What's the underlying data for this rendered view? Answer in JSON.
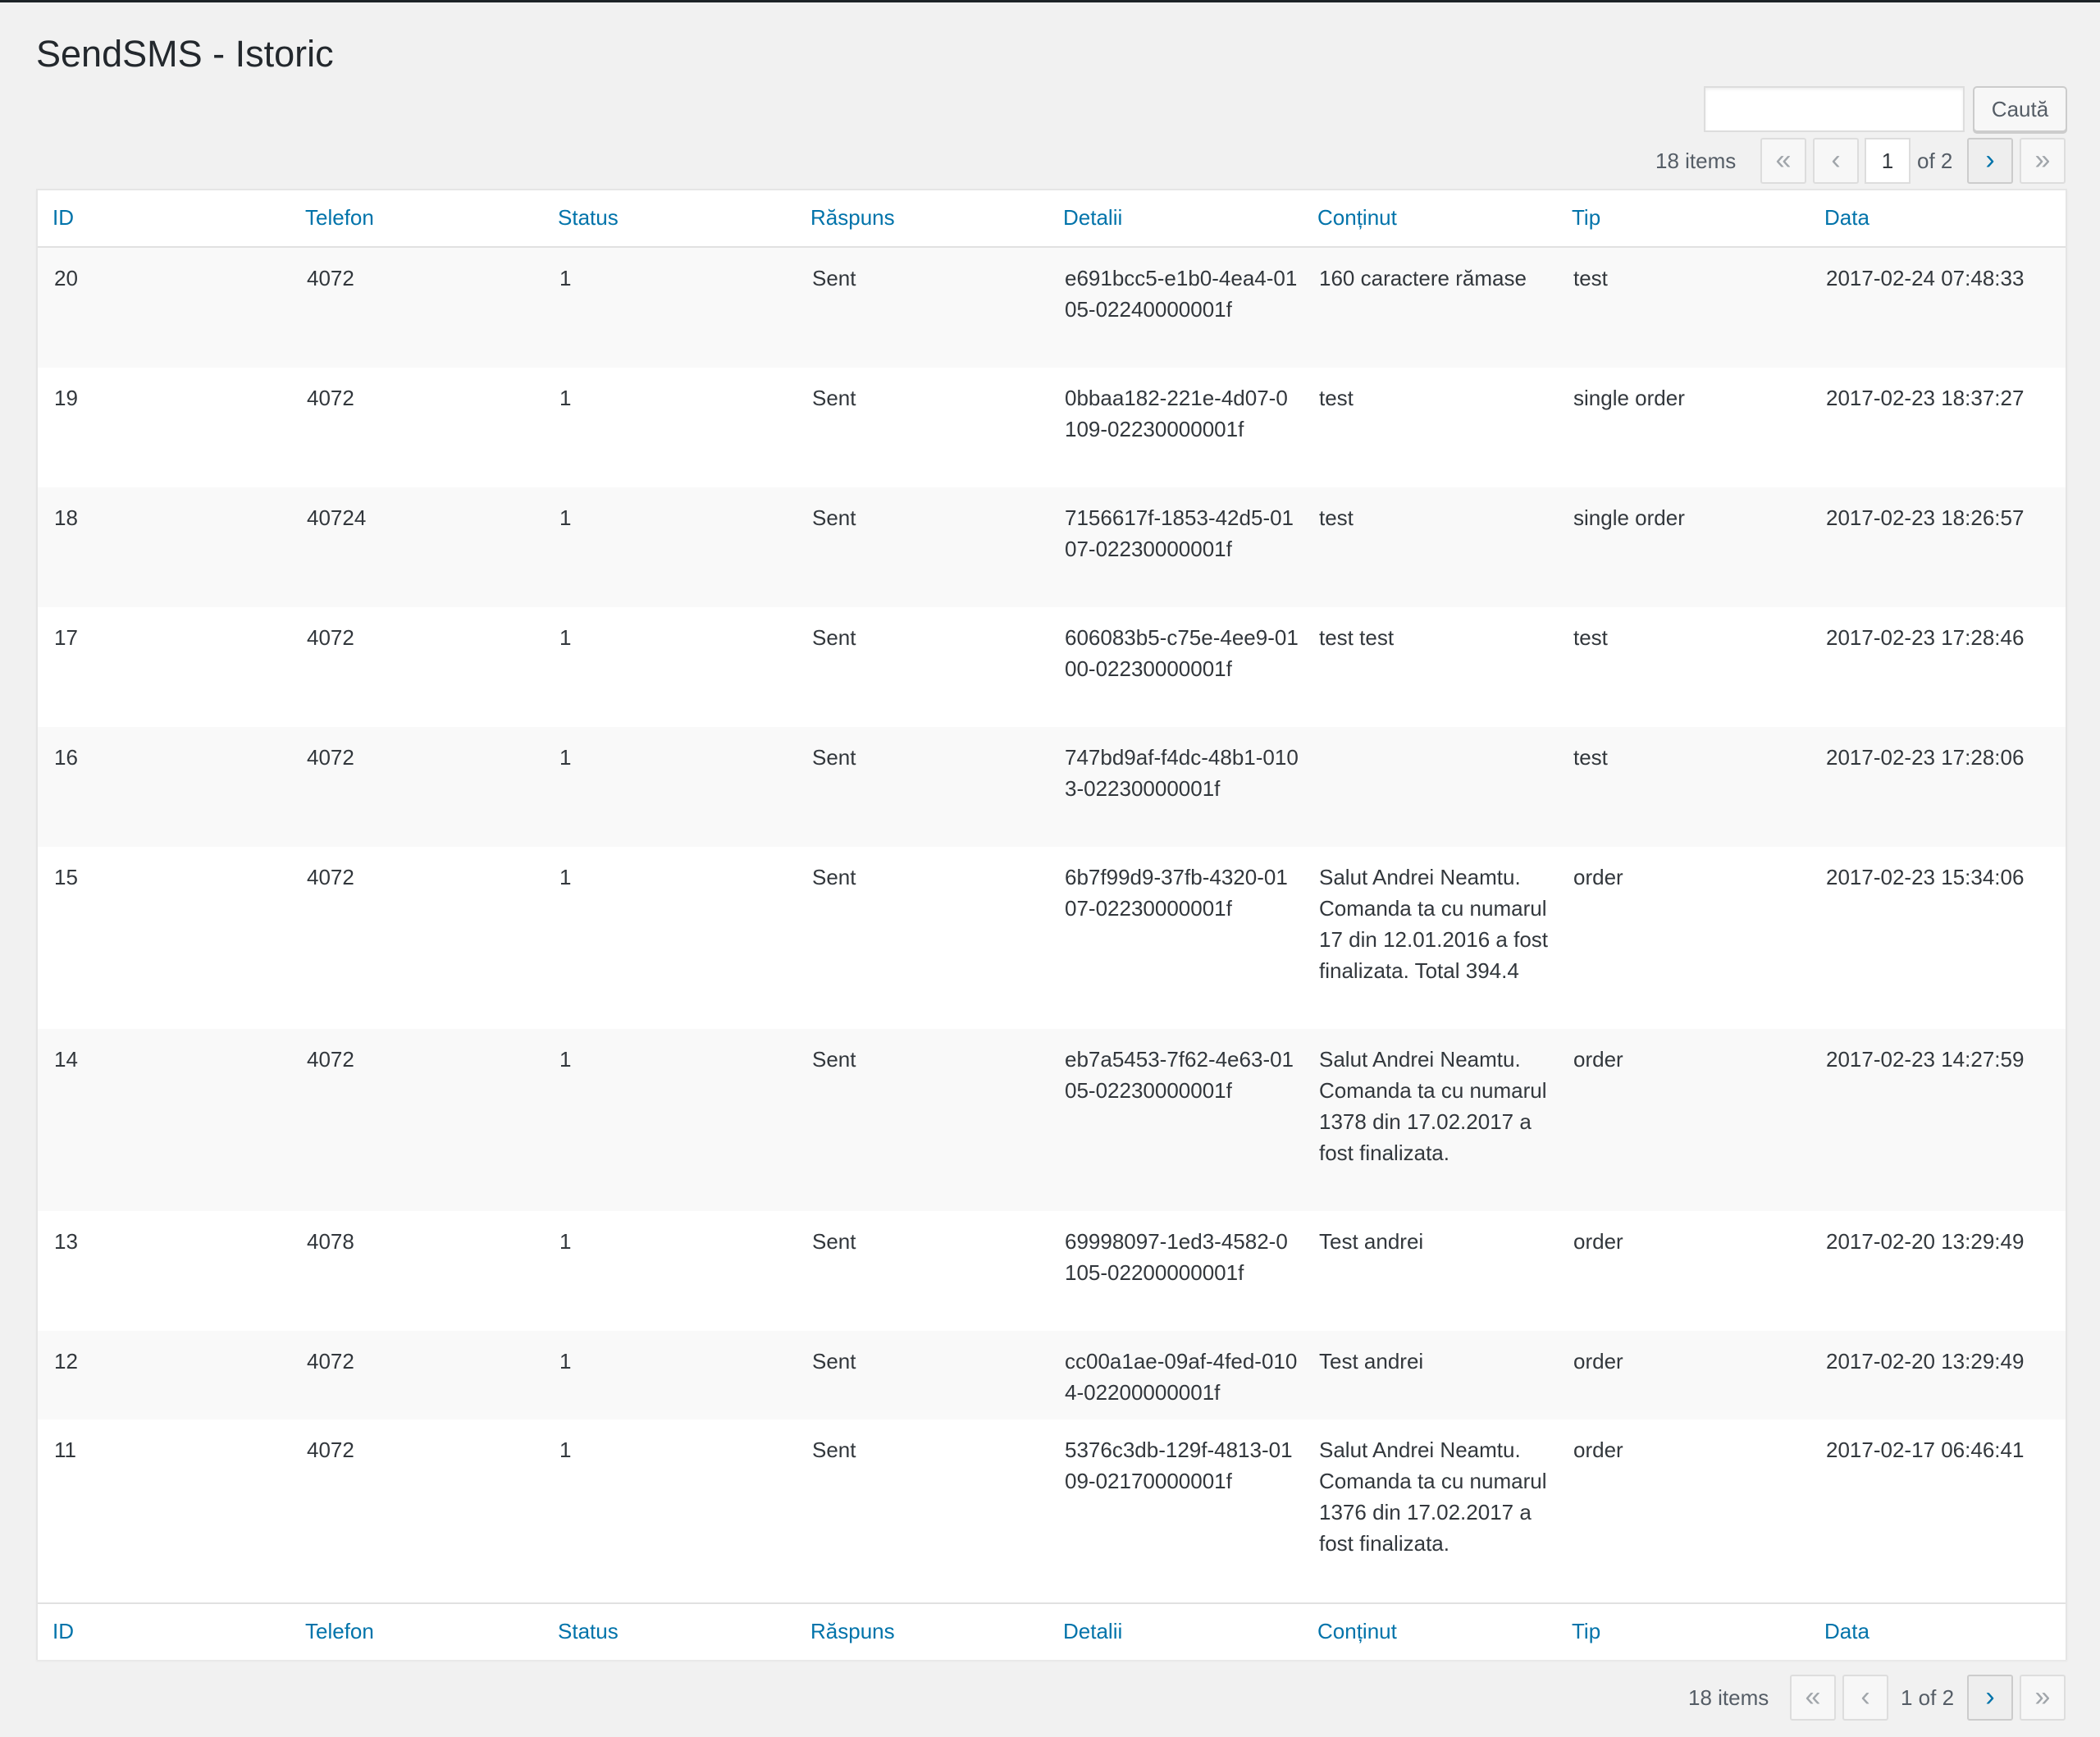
{
  "page": {
    "title": "SendSMS - Istoric"
  },
  "search": {
    "placeholder": "",
    "button_label": "Caută"
  },
  "pagination_top": {
    "items_text": "18 items",
    "first": "«",
    "prev": "‹",
    "current_page": "1",
    "of_text": "of 2",
    "next": "›",
    "last": "»"
  },
  "pagination_bottom": {
    "items_text": "18 items",
    "first": "«",
    "prev": "‹",
    "page_text": "1 of 2",
    "next": "›",
    "last": "»"
  },
  "columns": [
    "ID",
    "Telefon",
    "Status",
    "Răspuns",
    "Detalii",
    "Conținut",
    "Tip",
    "Data"
  ],
  "rows": [
    {
      "id": "20",
      "telefon": "4072",
      "status": "1",
      "raspuns": "Sent",
      "detalii": "e691bcc5-e1b0-4ea4-0105-02240000001f",
      "continut": "160 caractere rămase",
      "tip": "test",
      "data": "2017-02-24 07:48:33"
    },
    {
      "id": "19",
      "telefon": "4072",
      "status": "1",
      "raspuns": "Sent",
      "detalii": "0bbaa182-221e-4d07-0109-02230000001f",
      "continut": "test",
      "tip": "single order",
      "data": "2017-02-23 18:37:27"
    },
    {
      "id": "18",
      "telefon": "40724",
      "status": "1",
      "raspuns": "Sent",
      "detalii": "7156617f-1853-42d5-0107-02230000001f",
      "continut": "test",
      "tip": "single order",
      "data": "2017-02-23 18:26:57"
    },
    {
      "id": "17",
      "telefon": "4072",
      "status": "1",
      "raspuns": "Sent",
      "detalii": "606083b5-c75e-4ee9-0100-02230000001f",
      "continut": "test test",
      "tip": "test",
      "data": "2017-02-23 17:28:46"
    },
    {
      "id": "16",
      "telefon": "4072",
      "status": "1",
      "raspuns": "Sent",
      "detalii": "747bd9af-f4dc-48b1-0103-02230000001f",
      "continut": "",
      "tip": "test",
      "data": "2017-02-23 17:28:06"
    },
    {
      "id": "15",
      "telefon": "4072",
      "status": "1",
      "raspuns": "Sent",
      "detalii": "6b7f99d9-37fb-4320-0107-02230000001f",
      "continut": "Salut Andrei Neamtu. Comanda ta cu numarul 17 din 12.01.2016 a fost finalizata. Total 394.4",
      "tip": "order",
      "data": "2017-02-23 15:34:06"
    },
    {
      "id": "14",
      "telefon": "4072",
      "status": "1",
      "raspuns": "Sent",
      "detalii": "eb7a5453-7f62-4e63-0105-02230000001f",
      "continut": "Salut Andrei Neamtu. Comanda ta cu numarul 1378 din 17.02.2017 a fost finalizata.",
      "tip": "order",
      "data": "2017-02-23 14:27:59"
    },
    {
      "id": "13",
      "telefon": "4078",
      "status": "1",
      "raspuns": "Sent",
      "detalii": "69998097-1ed3-4582-0105-02200000001f",
      "continut": "Test andrei",
      "tip": "order",
      "data": "2017-02-20 13:29:49"
    },
    {
      "id": "12",
      "telefon": "4072",
      "status": "1",
      "raspuns": "Sent",
      "detalii": "cc00a1ae-09af-4fed-0104-02200000001f",
      "continut": "Test andrei",
      "tip": "order",
      "data": "2017-02-20 13:29:49"
    },
    {
      "id": "11",
      "telefon": "4072",
      "status": "1",
      "raspuns": "Sent",
      "detalii": "5376c3db-129f-4813-0109-02170000001f",
      "continut": "Salut Andrei Neamtu. Comanda ta cu numarul 1376 din 17.02.2017 a fost finalizata.",
      "tip": "order",
      "data": "2017-02-17 06:46:41"
    }
  ]
}
